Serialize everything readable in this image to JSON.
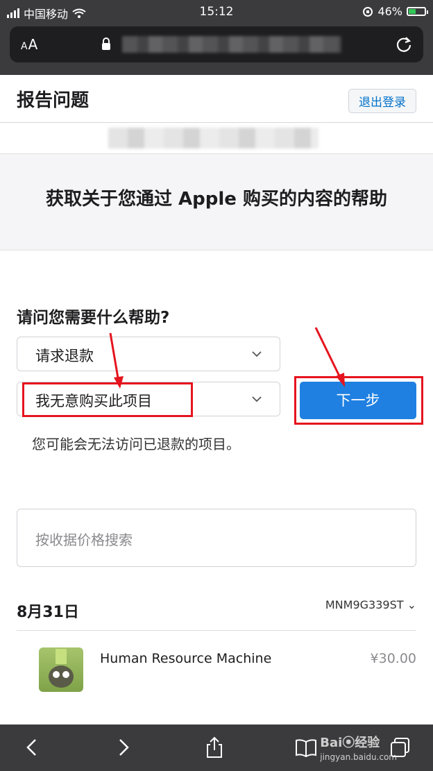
{
  "status_bar": {
    "carrier": "中国移动",
    "time": "15:12",
    "battery": "46%",
    "battery_level": 0.46
  },
  "browser": {
    "text_size_label_small": "A",
    "text_size_label_large": "A"
  },
  "header": {
    "title": "报告问题",
    "logout_label": "退出登录"
  },
  "hero": {
    "title": "获取关于您通过 Apple 购买的内容的帮助"
  },
  "form": {
    "question": "请问您需要什么帮助?",
    "select1_value": "请求退款",
    "select2_value": "我无意购买此项目",
    "next_label": "下一步",
    "note": "您可能会无法访问已退款的项目。"
  },
  "search": {
    "placeholder": "按收据价格搜索"
  },
  "purchases": {
    "date": "8月31日",
    "order_id": "MNM9G339ST ⌄",
    "items": [
      {
        "name": "Human Resource Machine",
        "price": "¥30.00"
      }
    ]
  },
  "watermark": {
    "brand": "Bai⦿经验",
    "url": "jingyan.baidu.com"
  },
  "colors": {
    "accent": "#1f80e1",
    "highlight": "#e5141e",
    "chrome": "#3b3b3d"
  }
}
